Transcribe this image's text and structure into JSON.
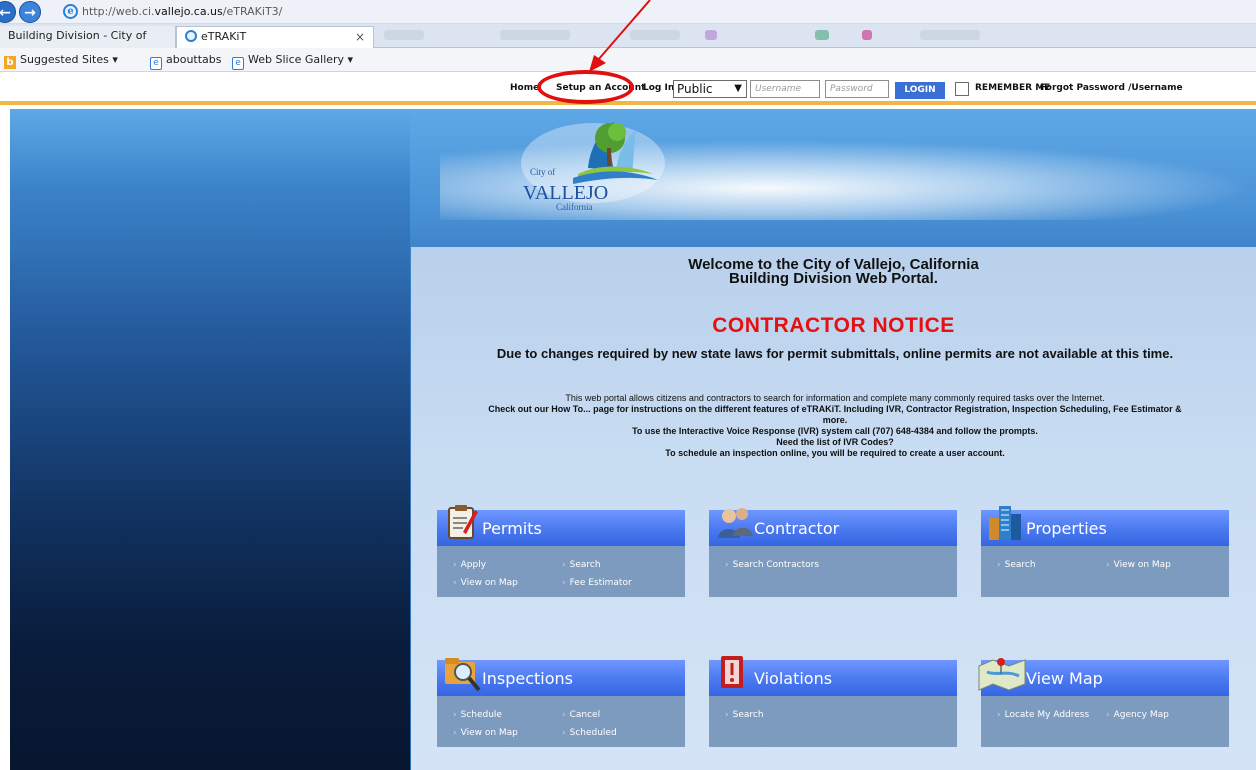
{
  "browser": {
    "url_prefix": "http://web.ci.",
    "url_domain": "vallejo.ca.us",
    "url_suffix": "/eTRAKiT3/",
    "tabs": [
      {
        "label": "Building Division - City of Valle..."
      },
      {
        "label": "eTRAKiT"
      }
    ],
    "tab_close": "×",
    "favorites": [
      {
        "label": "Suggested Sites ▾"
      },
      {
        "label": "abouttabs"
      },
      {
        "label": "Web Slice Gallery ▾"
      }
    ]
  },
  "topbar": {
    "home": "Home",
    "setup_account": "Setup an Account",
    "login_label": "Log In",
    "login_type": "Public",
    "username_placeholder": "Username",
    "password_placeholder": "Password",
    "login_button": "LOGIN",
    "remember_me": "REMEMBER ME",
    "forgot": "Forgot Password /Username"
  },
  "logo": {
    "city_of": "City of",
    "name": "VALLEJO",
    "state": "California"
  },
  "main": {
    "welcome_line1": "Welcome to the City of Vallejo, California",
    "welcome_line2": "Building Division Web Portal.",
    "notice_title": "CONTRACTOR NOTICE",
    "notice_body": "Due to changes required by new state laws for permit submittals, online permits are not available at this time.",
    "info1": "This web portal allows citizens and contractors to search for information and complete many commonly required tasks over the Internet.",
    "info2": "Check out our How To... page for instructions on the different features of eTRAKiT. Including IVR, Contractor Registration, Inspection Scheduling, Fee Estimator & more.",
    "info3": "To use the Interactive Voice Response (IVR) system call (707) 648-4384 and follow the prompts.",
    "info4": "Need the list of IVR Codes?",
    "info5": "To schedule an inspection online, you will be required to create a user account."
  },
  "tiles": [
    {
      "title": "Permits",
      "links": [
        "Apply",
        "Search",
        "View on Map",
        "Fee Estimator"
      ],
      "icon": "clipboard-icon"
    },
    {
      "title": "Contractor",
      "links": [
        "Search Contractors"
      ],
      "icon": "people-icon"
    },
    {
      "title": "Properties",
      "links": [
        "Search",
        "View on Map"
      ],
      "icon": "buildings-icon"
    },
    {
      "title": "Inspections",
      "links": [
        "Schedule",
        "Cancel",
        "View on Map",
        "Scheduled"
      ],
      "icon": "folder-magnifier-icon"
    },
    {
      "title": "Violations",
      "links": [
        "Search"
      ],
      "icon": "violation-book-icon"
    },
    {
      "title": "View Map",
      "links": [
        "Locate My Address",
        "Agency Map"
      ],
      "icon": "map-icon"
    }
  ],
  "colors": {
    "annotation": "#e01010",
    "accent_bar": "#f0b646",
    "notice_red": "#e31212",
    "tile_header": "#4a78ef",
    "tile_body": "#7d9bbf"
  }
}
